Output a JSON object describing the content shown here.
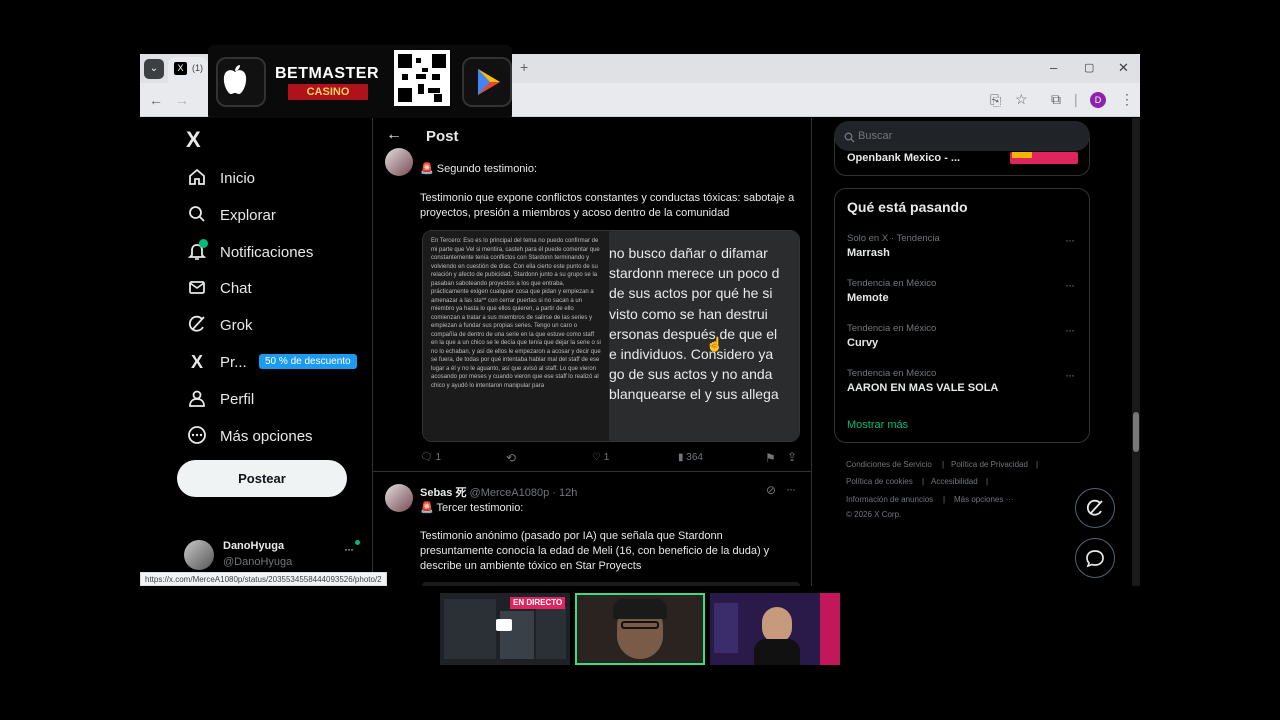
{
  "browser": {
    "tab_count_label": "(1)",
    "window_controls": [
      "–",
      "▢",
      "✕"
    ],
    "profile_initial": "D"
  },
  "ad": {
    "brand": "BETMASTER",
    "brand_sub": "CASINO"
  },
  "sidebar": {
    "logo": "X",
    "items": [
      {
        "label": "Inicio",
        "icon": "home-icon"
      },
      {
        "label": "Explorar",
        "icon": "search-icon"
      },
      {
        "label": "Notificaciones",
        "icon": "bell-icon"
      },
      {
        "label": "Chat",
        "icon": "mail-icon"
      },
      {
        "label": "Grok",
        "icon": "grok-icon"
      },
      {
        "label": "Pr...",
        "icon": "x-premium-icon",
        "badge": "50 % de descuento"
      },
      {
        "label": "Perfil",
        "icon": "person-icon"
      },
      {
        "label": "Más opciones",
        "icon": "more-circle-icon"
      }
    ],
    "post_button": "Postear",
    "account": {
      "name": "DanoHyuga",
      "handle": "@DanoHyuga"
    }
  },
  "header": {
    "title": "Post"
  },
  "tweet1": {
    "header_partial": "Sebas 死 @MerceA1080p · 12h",
    "lead": "🚨 Segundo testimonio:",
    "body": "Testimonio que expone conflictos constantes y conductas tóxicas: sabotaje a proyectos, presión a miembros y acoso dentro de la comunidad",
    "media_left": "En Tercero: Eso es lo principal del tema no puedo confirmar de mi parte que Vel si mentira, casteh para él puede comentar que constantemente tenía conflictos con Stardonn terminando y volviendo en cuestión de días. Con ella cierto este punto de su relación y afecto de pubicidad, Stardonn junto a su grupo se la pasaban saboteando proyectos a los que entraba, prácticamente exigen cualquier cosa que pidan y empiezan a amenazar a las sta** con cerrar puertas si no sacan a un miembro ya hasta lo que ellos quieren, a partir de ello comienzan a tratar a sus miembros de salirse de las series y empiezan a fundar sus propias series. Tengo un caro o compañía de dentro de una serie en la que estuve como staff en la que a un chico se le decía que tenía que dejar la serie o si no lo echaban, y así de ellos le empezaron a acosar y decir que se fuera, de todas por qué intentaba hablar mal del staff de ese lugar a él y no le aguanto, así que avisó al staff. Lo que vieron acosando por meses y cuando vieron que ese staff lo realizó al chico y ayudó lo intentaron manipular para",
    "media_right": [
      "no busco dañar o difamar",
      "stardonn merece un poco d",
      "de sus actos por qué he si",
      "visto como se han destrui",
      "ersonas después de que el",
      "e individuos. Considero ya",
      "go de sus actos y no anda",
      "blanquearse el y sus allega"
    ],
    "replies": "1",
    "likes": "1",
    "views": "364"
  },
  "tweet2": {
    "name": "Sebas 死",
    "handle": "@MerceA1080p",
    "time": "· 12h",
    "lead": "🚨 Tercer testimonio:",
    "body": "Testimonio anónimo (pasado por IA) que señala que Stardonn presuntamente conocía la edad de Meli (16, con beneficio de la duda) y describe un ambiente tóxico en Star Proyects"
  },
  "status_url": "https://x.com/MerceA1080p/status/2035534558444093526/photo/2",
  "right": {
    "search_placeholder": "Buscar",
    "partial_card": "Openbank Mexico - ...",
    "trends_title": "Qué está pasando",
    "trends": [
      {
        "meta": "Solo en X · Tendencia",
        "title": "Marrash"
      },
      {
        "meta": "Tendencia en México",
        "title": "Memote"
      },
      {
        "meta": "Tendencia en México",
        "title": "Curvy"
      },
      {
        "meta": "Tendencia en México",
        "title": "AARON EN MAS VALE SOLA"
      }
    ],
    "show_more": "Mostrar más",
    "footer": {
      "terms": "Condiciones de Servicio",
      "privacy": "Política de Privacidad",
      "cookies": "Política de cookies",
      "accessibility": "Accesibilidad",
      "ads_info": "Información de anuncios",
      "more": "Más opciones ···",
      "copyright": "© 2026 X Corp."
    }
  },
  "stream": {
    "live_badge": "EN DIRECTO"
  },
  "colors": {
    "accent_blue": "#1d9bf0",
    "show_more_green": "#00ba7c",
    "badge_red": "#e0245e"
  }
}
